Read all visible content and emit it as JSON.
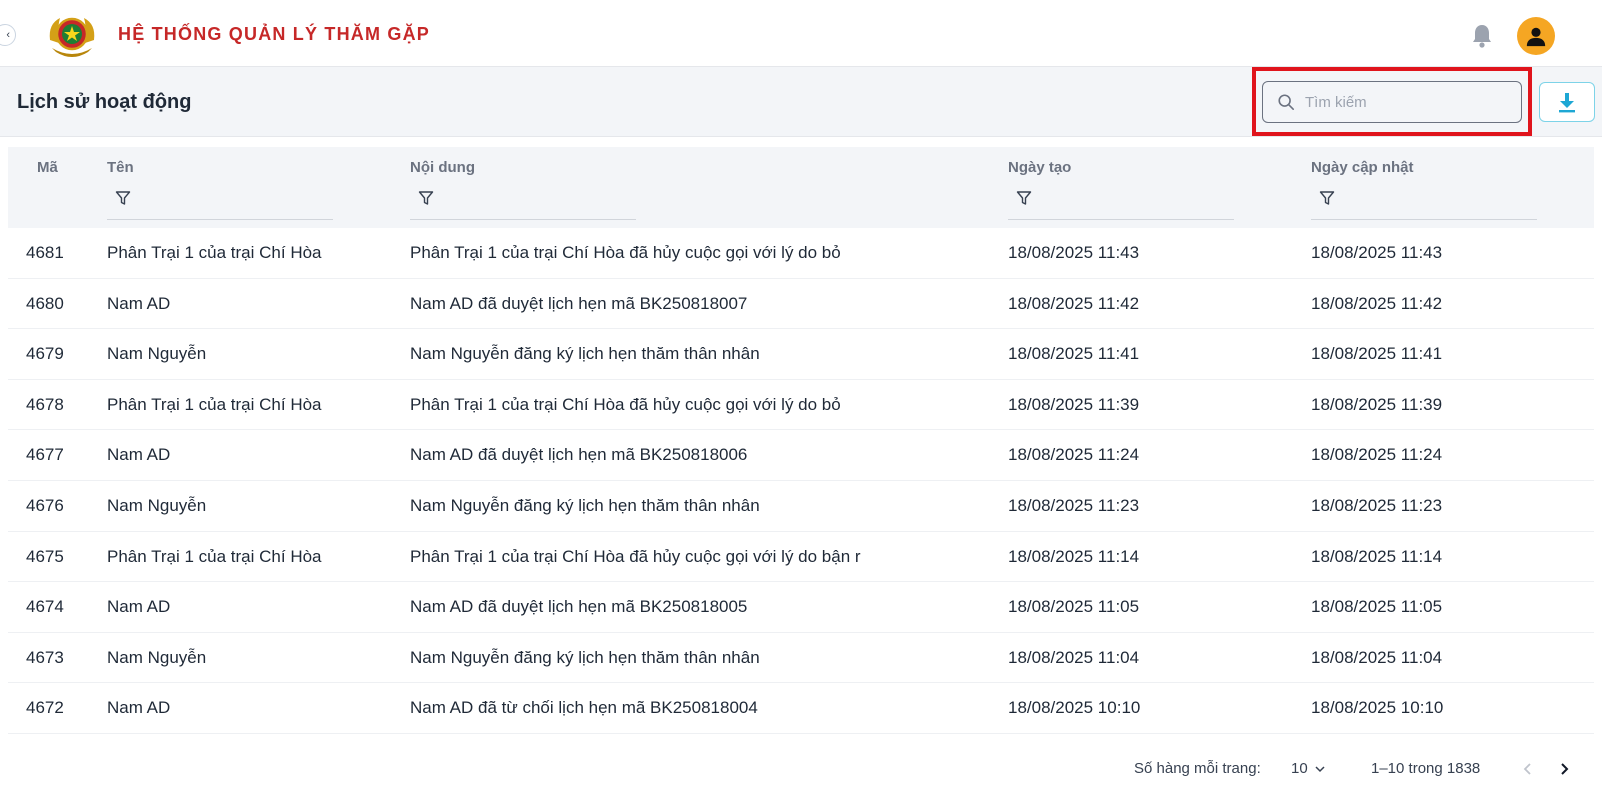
{
  "app": {
    "title": "HỆ THỐNG QUẢN LÝ THĂM GẶP",
    "brand_color": "#c62828",
    "avatar_color": "#f5a623"
  },
  "page": {
    "title": "Lịch sử hoạt động"
  },
  "search": {
    "placeholder": "Tìm kiếm",
    "value": ""
  },
  "table": {
    "columns": [
      "Mã",
      "Tên",
      "Nội dung",
      "Ngày tạo",
      "Ngày cập nhật"
    ],
    "rows": [
      {
        "id": "4681",
        "name": "Phân Trại 1 của trại Chí Hòa",
        "content": "Phân Trại 1 của trại Chí Hòa đã hủy cuộc gọi với lý do bỏ",
        "created": "18/08/2025 11:43",
        "updated": "18/08/2025 11:43"
      },
      {
        "id": "4680",
        "name": "Nam AD",
        "content": "Nam AD đã duyệt lịch hẹn mã BK250818007",
        "created": "18/08/2025 11:42",
        "updated": "18/08/2025 11:42"
      },
      {
        "id": "4679",
        "name": "Nam Nguyễn",
        "content": "Nam Nguyễn đăng ký lịch hẹn thăm thân nhân",
        "created": "18/08/2025 11:41",
        "updated": "18/08/2025 11:41"
      },
      {
        "id": "4678",
        "name": "Phân Trại 1 của trại Chí Hòa",
        "content": "Phân Trại 1 của trại Chí Hòa đã hủy cuộc gọi với lý do bỏ",
        "created": "18/08/2025 11:39",
        "updated": "18/08/2025 11:39"
      },
      {
        "id": "4677",
        "name": "Nam AD",
        "content": "Nam AD đã duyệt lịch hẹn mã BK250818006",
        "created": "18/08/2025 11:24",
        "updated": "18/08/2025 11:24"
      },
      {
        "id": "4676",
        "name": "Nam Nguyễn",
        "content": "Nam Nguyễn đăng ký lịch hẹn thăm thân nhân",
        "created": "18/08/2025 11:23",
        "updated": "18/08/2025 11:23"
      },
      {
        "id": "4675",
        "name": "Phân Trại 1 của trại Chí Hòa",
        "content": "Phân Trại 1 của trại Chí Hòa đã hủy cuộc gọi với lý do bận r",
        "created": "18/08/2025 11:14",
        "updated": "18/08/2025 11:14"
      },
      {
        "id": "4674",
        "name": "Nam AD",
        "content": "Nam AD đã duyệt lịch hẹn mã BK250818005",
        "created": "18/08/2025 11:05",
        "updated": "18/08/2025 11:05"
      },
      {
        "id": "4673",
        "name": "Nam Nguyễn",
        "content": "Nam Nguyễn đăng ký lịch hẹn thăm thân nhân",
        "created": "18/08/2025 11:04",
        "updated": "18/08/2025 11:04"
      },
      {
        "id": "4672",
        "name": "Nam AD",
        "content": "Nam AD đã từ chối lịch hẹn mã BK250818004",
        "created": "18/08/2025 10:10",
        "updated": "18/08/2025 10:10"
      }
    ]
  },
  "pagination": {
    "rows_per_page_label": "Số hàng mỗi trang:",
    "rows_per_page": "10",
    "range": "1–10 trong 1838"
  },
  "icons": {
    "logo": "police-emblem-icon",
    "notifications": "bell-icon",
    "user": "user-avatar-icon",
    "search": "search-icon",
    "download": "download-icon",
    "filter": "filter-icon",
    "prev": "chevron-left-icon",
    "next": "chevron-right-icon"
  }
}
